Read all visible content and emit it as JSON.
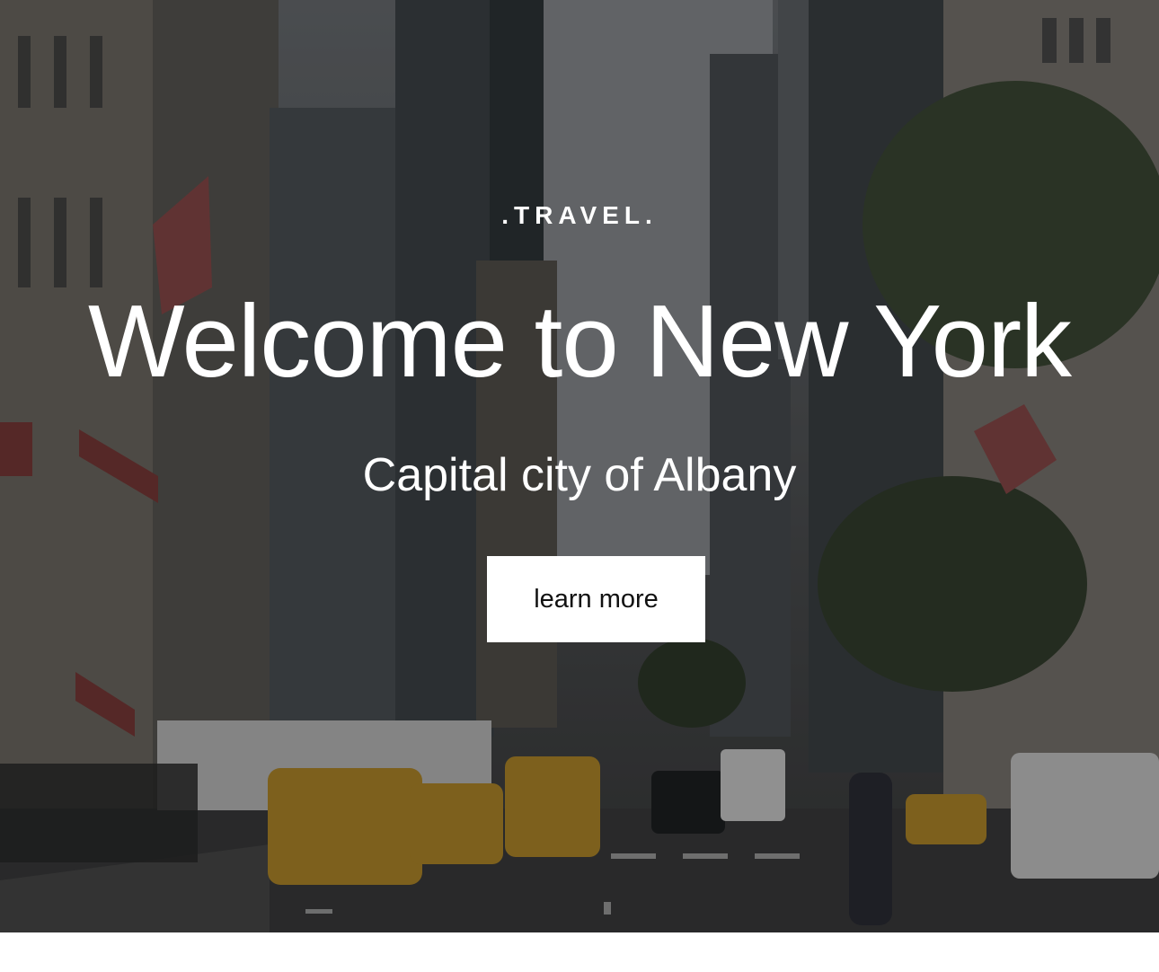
{
  "hero": {
    "eyebrow": ".TRAVEL.",
    "title": "Welcome to New York",
    "subtitle": "Capital city of Albany",
    "cta_label": "learn more",
    "background_image": "new-york-street-photo"
  }
}
